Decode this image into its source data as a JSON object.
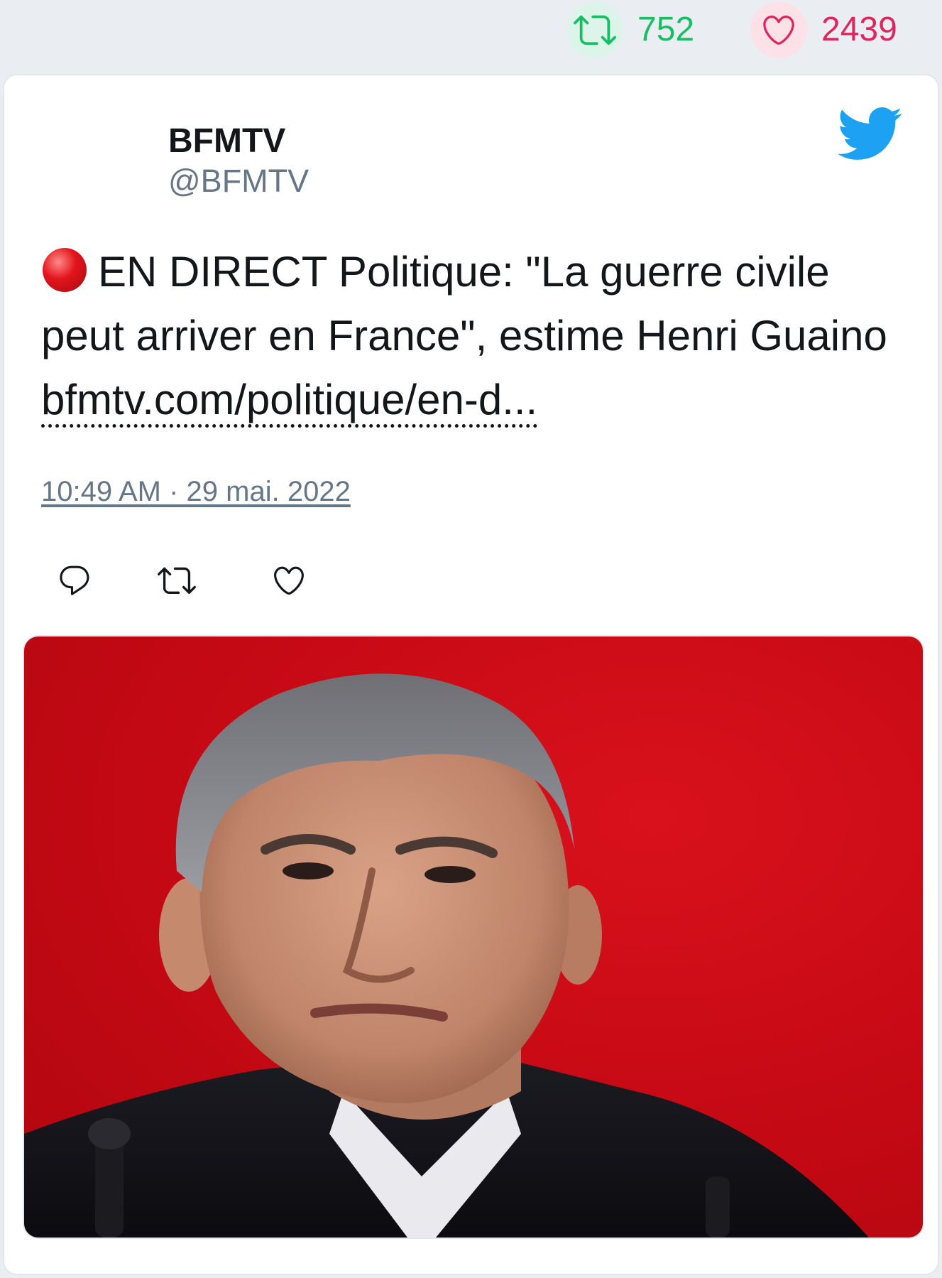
{
  "engagement": {
    "retweet_count": "752",
    "like_count": "2439",
    "retweet_color": "#17bf63",
    "like_color": "#e0245e"
  },
  "tweet": {
    "author_name": "BFMTV",
    "author_handle": "@BFMTV",
    "platform_icon": "twitter-bird-icon",
    "live_icon": "red-circle-icon",
    "text": "EN DIRECT Politique: \"La guerre civile peut arriver en France\", estime Henri Guaino ",
    "link_text": "bfmtv.com/politique/en-d...",
    "timestamp": "10:49 AM · 29 mai. 2022",
    "actions": [
      "reply-icon",
      "retweet-icon",
      "like-icon"
    ]
  },
  "colors": {
    "page_background": "#eaedf1",
    "card_background": "#ffffff",
    "twitter_blue": "#1da1f2",
    "media_background": "#c40914"
  }
}
